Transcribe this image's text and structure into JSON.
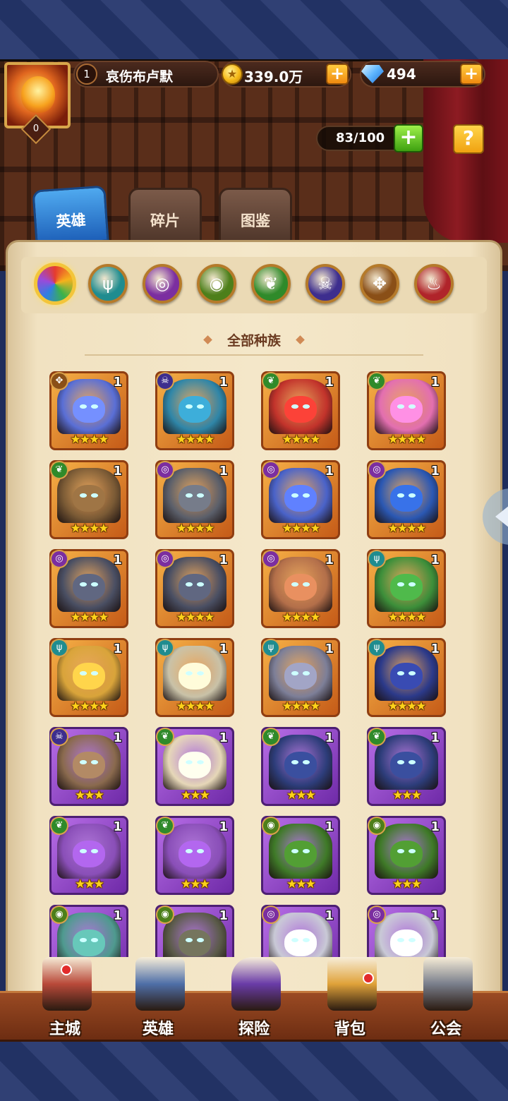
{
  "player": {
    "level": "1",
    "name": "哀伤布卢默",
    "avatar_level": "0"
  },
  "resources": {
    "gold": "339.0万",
    "gems": "494"
  },
  "hero_capacity": "83/100",
  "tabs": [
    {
      "label": "英雄",
      "active": true
    },
    {
      "label": "碎片",
      "active": false
    },
    {
      "label": "图鉴",
      "active": false
    }
  ],
  "faction_filters": [
    {
      "name": "all",
      "color": "#f3c53a",
      "selected": true
    },
    {
      "name": "water",
      "color": "#1f8c8f",
      "selected": false
    },
    {
      "name": "arcane",
      "color": "#7b2ea0",
      "selected": false
    },
    {
      "name": "nature-eye",
      "color": "#4d7f1a",
      "selected": false
    },
    {
      "name": "forest",
      "color": "#2f8a2a",
      "selected": false
    },
    {
      "name": "undead",
      "color": "#3d2e8e",
      "selected": false
    },
    {
      "name": "light",
      "color": "#8a4f17",
      "selected": false
    },
    {
      "name": "chaos",
      "color": "#b0242a",
      "selected": false
    }
  ],
  "race_label": "全部种族",
  "heroes": [
    {
      "race": "light",
      "level": "1",
      "stars": "★★★★",
      "frame": "orange",
      "color": "#5a6fd6"
    },
    {
      "race": "undead",
      "level": "1",
      "stars": "★★★★",
      "frame": "orange",
      "color": "#2f86a8"
    },
    {
      "race": "forest",
      "level": "1",
      "stars": "★★★★",
      "frame": "orange",
      "color": "#c2332b"
    },
    {
      "race": "forest",
      "level": "1",
      "stars": "★★★★",
      "frame": "orange",
      "color": "#e36fb0"
    },
    {
      "race": "forest",
      "level": "1",
      "stars": "★★★★",
      "frame": "orange",
      "color": "#7a5a35"
    },
    {
      "race": "arcane",
      "level": "1",
      "stars": "★★★★",
      "frame": "orange",
      "color": "#5b5f6a"
    },
    {
      "race": "arcane",
      "level": "1",
      "stars": "★★★★",
      "frame": "orange",
      "color": "#4a63c9"
    },
    {
      "race": "arcane",
      "level": "1",
      "stars": "★★★★",
      "frame": "orange",
      "color": "#2b58b3"
    },
    {
      "race": "arcane",
      "level": "1",
      "stars": "★★★★",
      "frame": "orange",
      "color": "#4a4f63"
    },
    {
      "race": "arcane",
      "level": "1",
      "stars": "★★★★",
      "frame": "orange",
      "color": "#4a4f63"
    },
    {
      "race": "arcane",
      "level": "1",
      "stars": "★★★★",
      "frame": "orange",
      "color": "#b36f4a"
    },
    {
      "race": "water",
      "level": "1",
      "stars": "★★★★",
      "frame": "orange",
      "color": "#3d8f3a"
    },
    {
      "race": "water",
      "level": "1",
      "stars": "★★★★",
      "frame": "orange",
      "color": "#d9a43a"
    },
    {
      "race": "water",
      "level": "1",
      "stars": "★★★★",
      "frame": "orange",
      "color": "#c9c2a8"
    },
    {
      "race": "water",
      "level": "1",
      "stars": "★★★★",
      "frame": "orange",
      "color": "#7d7f98"
    },
    {
      "race": "water",
      "level": "1",
      "stars": "★★★★",
      "frame": "orange",
      "color": "#2c3a8a"
    },
    {
      "race": "undead",
      "level": "1",
      "stars": "★★★",
      "frame": "purple",
      "color": "#8a6a4e"
    },
    {
      "race": "forest",
      "level": "1",
      "stars": "★★★",
      "frame": "purple",
      "color": "#e6d7b8"
    },
    {
      "race": "forest",
      "level": "1",
      "stars": "★★★",
      "frame": "purple",
      "color": "#2d3d7a"
    },
    {
      "race": "forest",
      "level": "1",
      "stars": "★★★",
      "frame": "purple",
      "color": "#2d3d7a"
    },
    {
      "race": "forest",
      "level": "1",
      "stars": "★★★",
      "frame": "purple",
      "color": "#8a4fb8"
    },
    {
      "race": "forest",
      "level": "1",
      "stars": "★★★",
      "frame": "purple",
      "color": "#8a4fb8"
    },
    {
      "race": "nature-eye",
      "level": "1",
      "stars": "★★★",
      "frame": "purple",
      "color": "#3f7a28"
    },
    {
      "race": "nature-eye",
      "level": "1",
      "stars": "★★★",
      "frame": "purple",
      "color": "#3f7a28"
    },
    {
      "race": "nature-eye",
      "level": "1",
      "stars": "",
      "frame": "purple",
      "color": "#4f9a8f"
    },
    {
      "race": "nature-eye",
      "level": "1",
      "stars": "",
      "frame": "purple",
      "color": "#5a5a48"
    },
    {
      "race": "arcane",
      "level": "1",
      "stars": "",
      "frame": "purple",
      "color": "#c9c9d6"
    },
    {
      "race": "arcane",
      "level": "1",
      "stars": "",
      "frame": "purple",
      "color": "#c9c9d6"
    }
  ],
  "bottom_nav": [
    {
      "label": "主城",
      "icon": "castle-icon",
      "color": "#b94a3a"
    },
    {
      "label": "英雄",
      "icon": "hero-icon",
      "color": "#4f6fa8"
    },
    {
      "label": "探险",
      "icon": "portal-icon",
      "color": "#6a3ca8"
    },
    {
      "label": "背包",
      "icon": "backpack-icon",
      "color": "#e0a23a"
    },
    {
      "label": "公会",
      "icon": "guild-tower-icon",
      "color": "#7a7f8c"
    }
  ]
}
